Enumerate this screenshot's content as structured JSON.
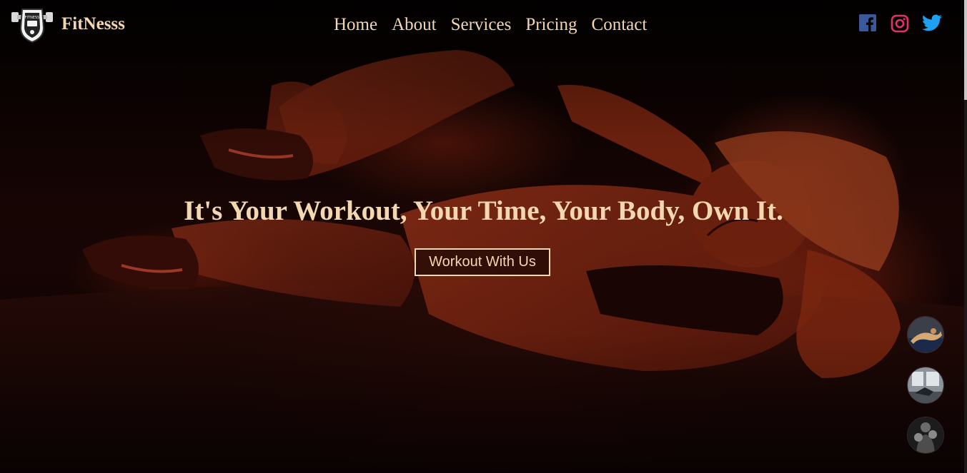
{
  "brand": {
    "name": "FitNesss",
    "logo_icon": "gym-dumbbell-shield-icon"
  },
  "nav": {
    "items": [
      {
        "label": "Home"
      },
      {
        "label": "About"
      },
      {
        "label": "Services"
      },
      {
        "label": "Pricing"
      },
      {
        "label": "Contact"
      }
    ]
  },
  "social": [
    {
      "icon": "facebook-icon",
      "color": "#3b5998"
    },
    {
      "icon": "instagram-icon",
      "color": "#e1306c"
    },
    {
      "icon": "twitter-icon",
      "color": "#1da1f2"
    }
  ],
  "hero": {
    "headline": "It's Your Workout, Your Time, Your Body, Own It.",
    "cta_label": "Workout With Us",
    "background": "woman-doing-crunches-photo"
  },
  "thumbnails": [
    {
      "icon": "workout-photo-thumbnail-1"
    },
    {
      "icon": "gym-photo-thumbnail-2"
    },
    {
      "icon": "boxer-photo-thumbnail-3"
    }
  ],
  "colors": {
    "accent": "#f3d7b0",
    "background": "#0a0303",
    "hero_tint": "#8a2a12"
  }
}
